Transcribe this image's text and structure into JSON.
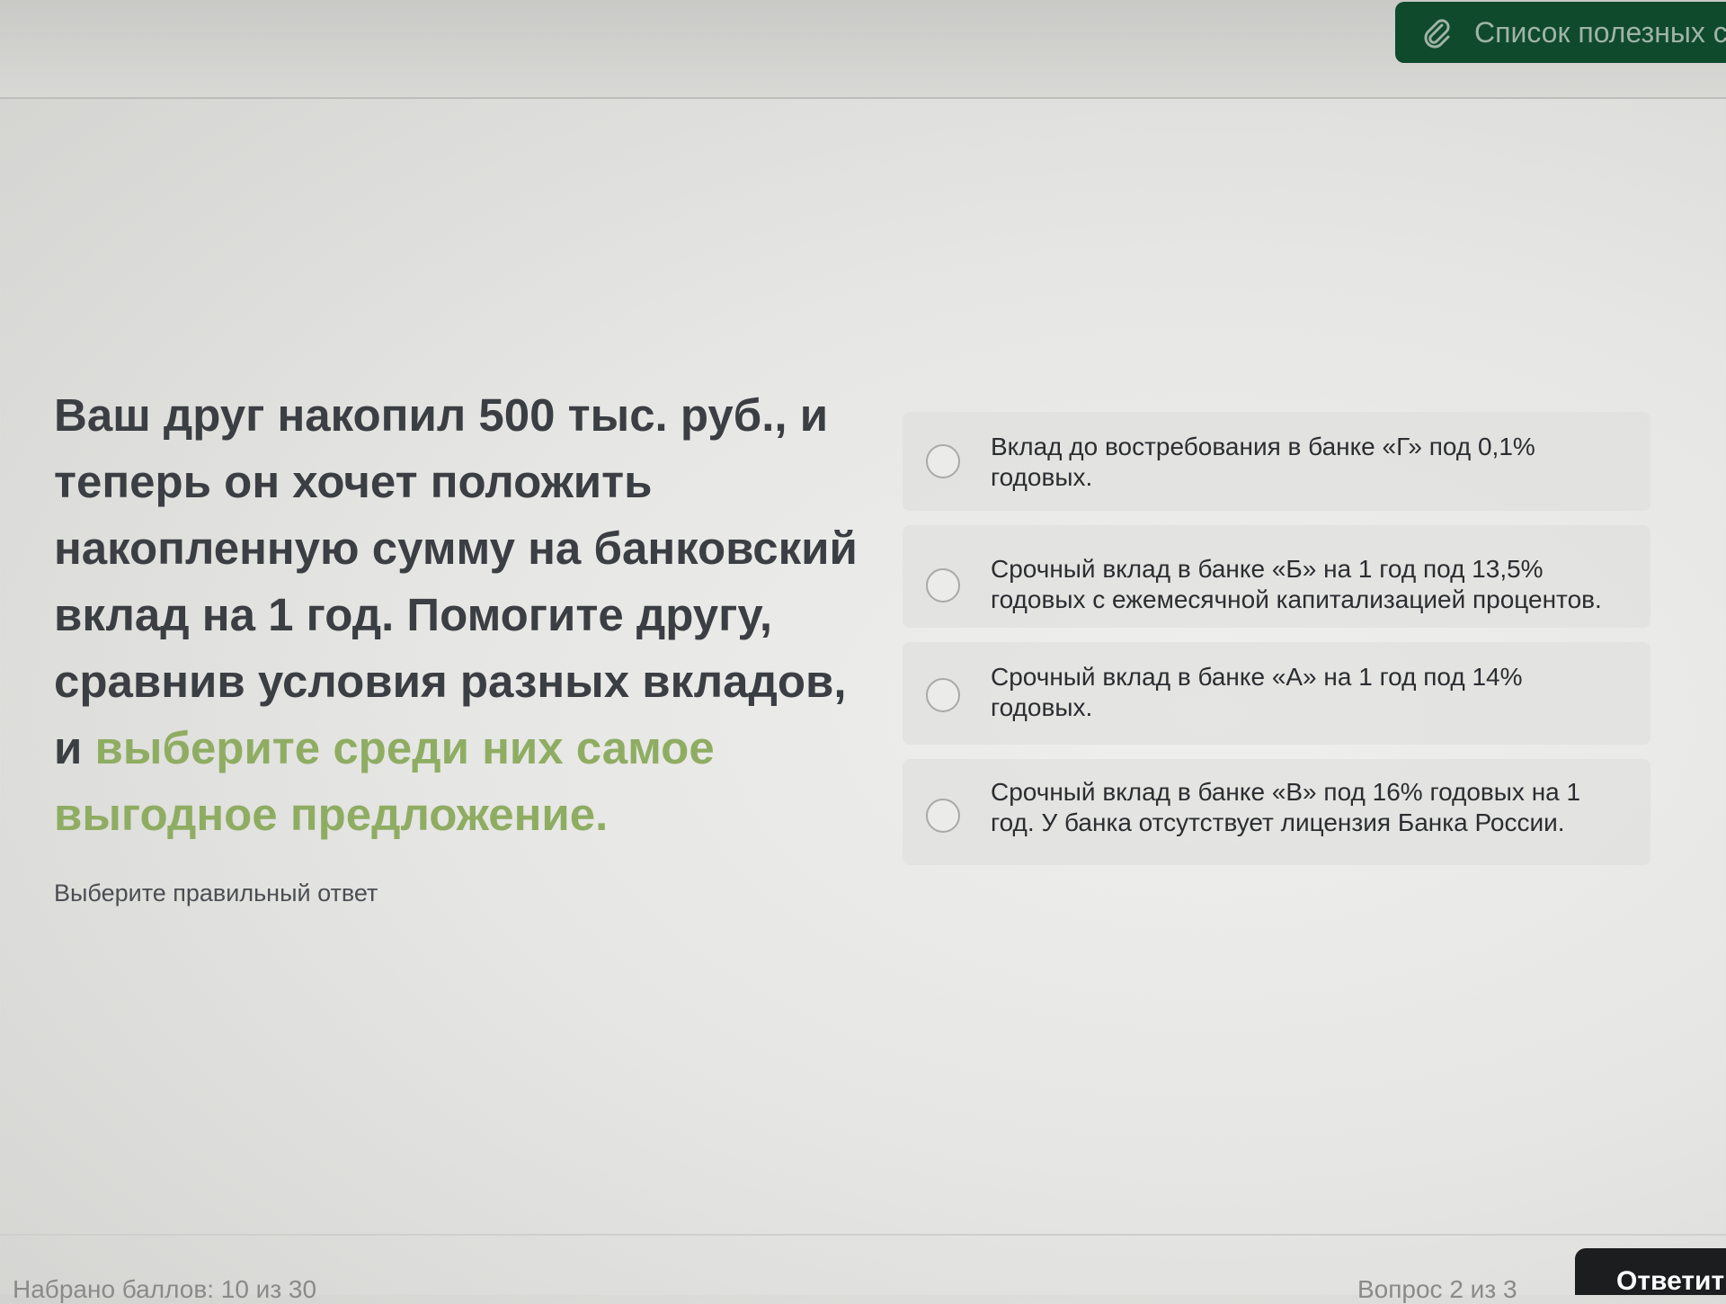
{
  "header": {
    "useful_links_label": "Список полезных с",
    "useful_links_icon": "paperclip-icon"
  },
  "question": {
    "text_plain": "Ваш друг накопил 500 тыс. руб., и теперь он хочет положить накопленную сумму на банковский вклад на 1 год. Помогите другу, сравнив условия разных вкладов, и ",
    "text_highlight": "выберите среди них самое выгодное предложение.",
    "hint": "Выберите правильный ответ"
  },
  "answers": [
    {
      "label": "Вклад до востребования в банке «Г» под 0,1% годовых."
    },
    {
      "label": "Срочный вклад в банке «Б» на 1 год под 13,5% годовых с ежемесячной капитализацией процентов."
    },
    {
      "label": "Срочный вклад в банке «А» на 1 год под 14% годовых."
    },
    {
      "label": "Срочный вклад в банке «В» под 16% годовых на 1 год. У банка отсутствует лицензия Банка России."
    }
  ],
  "footer": {
    "score": "Набрано баллов: 10 из 30",
    "counter": "Вопрос 2 из 3",
    "answer_button": "Ответить"
  },
  "colors": {
    "highlight": "#8fad62",
    "links_button": "#0f4a2c",
    "answer_button": "#1c1d1e"
  }
}
